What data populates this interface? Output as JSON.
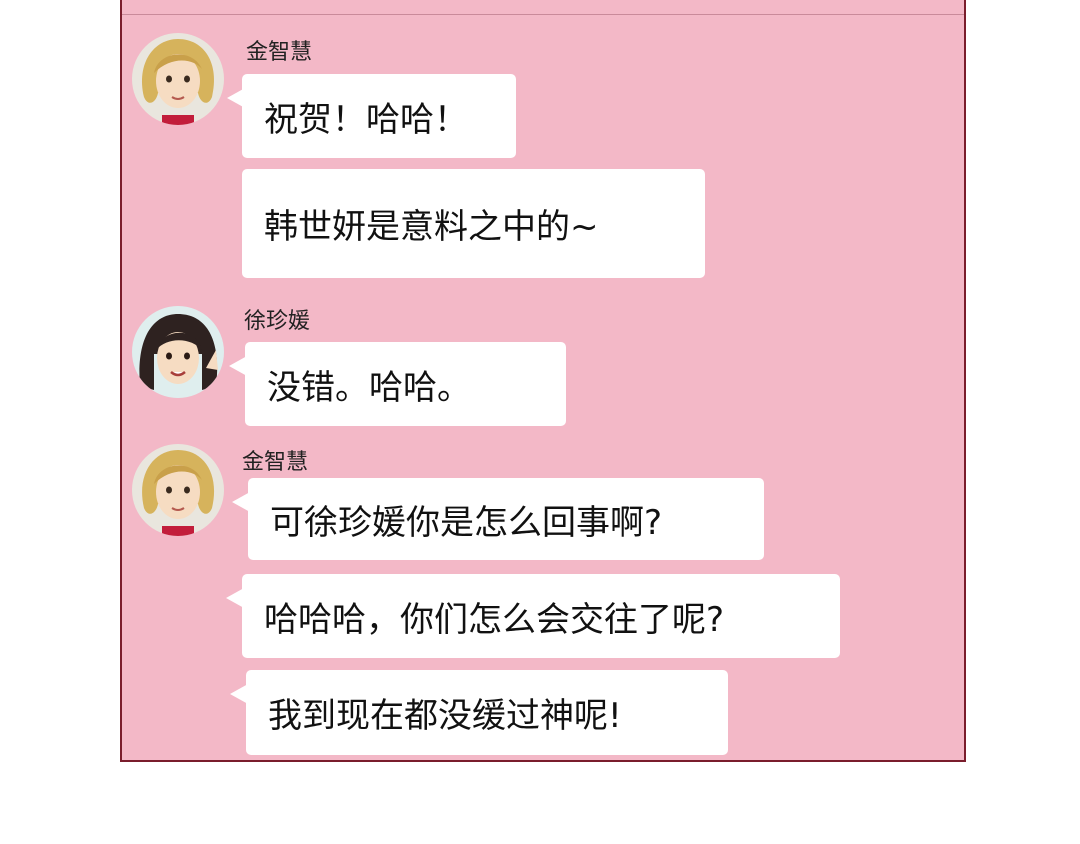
{
  "messages": [
    {
      "sender": "金智慧",
      "bubbles": [
        "祝贺！哈哈！",
        "韩世妍是意料之中的~"
      ]
    },
    {
      "sender": "徐珍媛",
      "bubbles": [
        "没错。哈哈。"
      ]
    },
    {
      "sender": "金智慧",
      "bubbles": [
        "可徐珍媛你是怎么回事啊?",
        "哈哈哈，你们怎么会交往了呢?",
        "我到现在都没缓过神呢!"
      ]
    }
  ],
  "colors": {
    "background": "#ffffff",
    "chat_background": "#f3b8c7",
    "frame_border": "#7a1d2c",
    "bubble": "#ffffff"
  },
  "icons": [
    "kim-jihye-avatar",
    "seo-jinwon-avatar"
  ]
}
